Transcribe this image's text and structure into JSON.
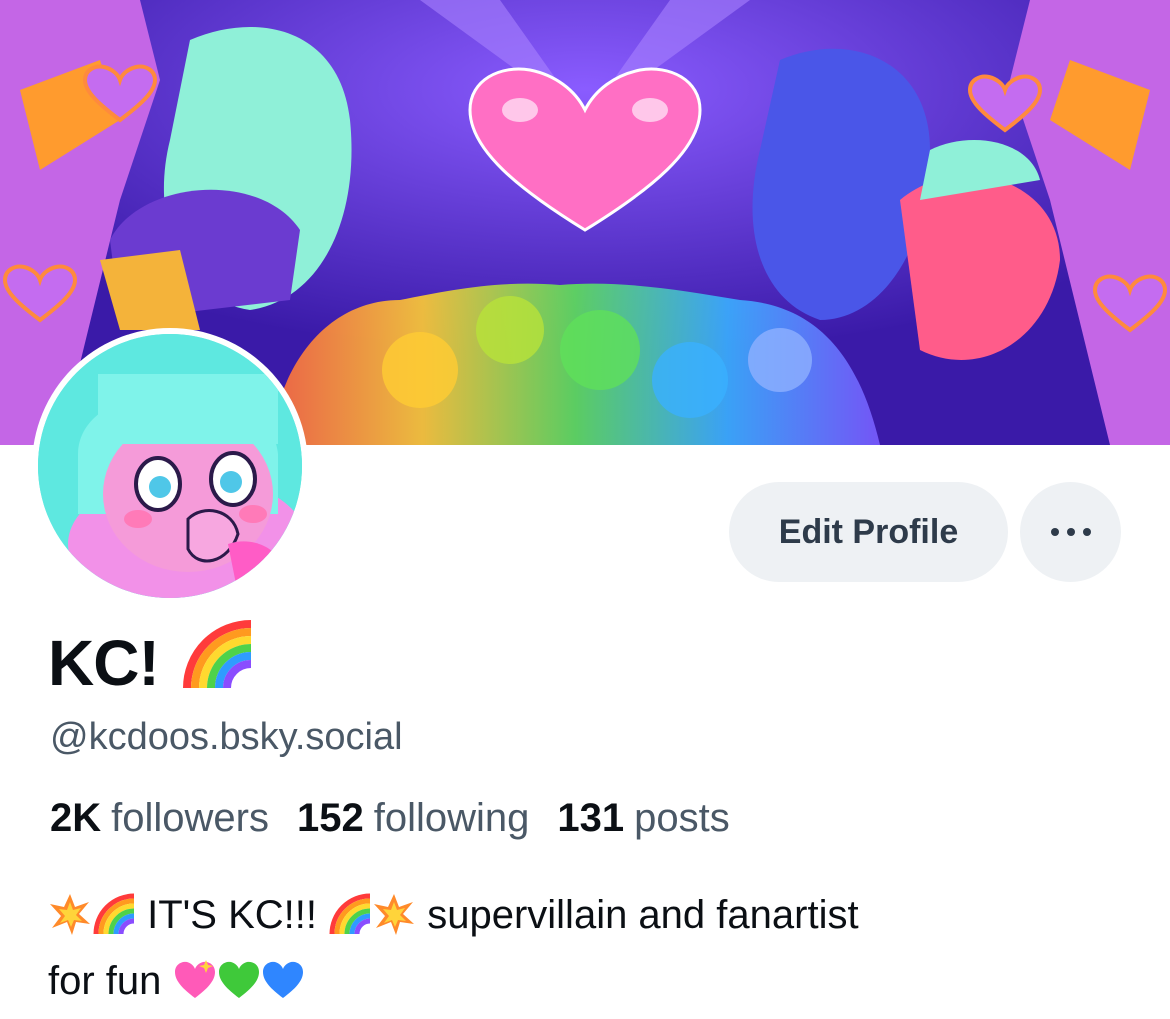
{
  "banner": {
    "description_icon": "banner-artwork"
  },
  "avatar": {
    "icon": "avatar-artwork"
  },
  "actions": {
    "edit_profile_label": "Edit Profile",
    "more_icon": "ellipsis-icon"
  },
  "profile": {
    "display_name": "KC!",
    "display_emoji": "rainbow",
    "handle": "@kcdoos.bsky.social"
  },
  "stats": {
    "followers_count": "2K",
    "followers_label": "followers",
    "following_count": "152",
    "following_label": "following",
    "posts_count": "131",
    "posts_label": "posts"
  },
  "bio": {
    "part1": " IT'S KC!!! ",
    "part2": " supervillain and fanartist",
    "part3": "for fun "
  },
  "colors": {
    "button_bg": "#eef1f4",
    "secondary_text": "#4a5866",
    "primary_text": "#0b0f14"
  }
}
